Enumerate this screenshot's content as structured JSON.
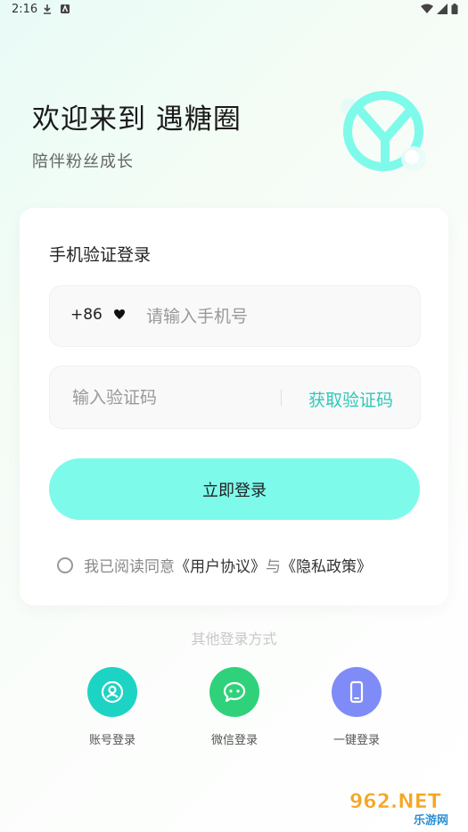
{
  "status_bar": {
    "time": "2:16"
  },
  "hero": {
    "welcome": "欢迎来到 遇糖圈",
    "tagline": "陪伴粉丝成长"
  },
  "login_card": {
    "title": "手机验证登录",
    "country_code": "+86",
    "phone_placeholder": "请输入手机号",
    "code_placeholder": "输入验证码",
    "get_code_label": "获取验证码",
    "login_button": "立即登录",
    "agreement": {
      "prefix": "我已阅读同意",
      "user_agreement": "《用户协议》",
      "conjunction": "与",
      "privacy_policy": "《隐私政策》"
    }
  },
  "other_login": {
    "title": "其他登录方式",
    "options": [
      {
        "label": "账号登录",
        "icon": "user-icon",
        "color": "#1dd3c3"
      },
      {
        "label": "微信登录",
        "icon": "wechat-icon",
        "color": "#2fd27a"
      },
      {
        "label": "一键登录",
        "icon": "phone-icon",
        "color": "#7f8cf7"
      }
    ]
  },
  "watermark": {
    "text": "962.NET",
    "subtext": "乐游网"
  },
  "colors": {
    "accent": "#7efaeb",
    "link": "#2ec9b8"
  }
}
